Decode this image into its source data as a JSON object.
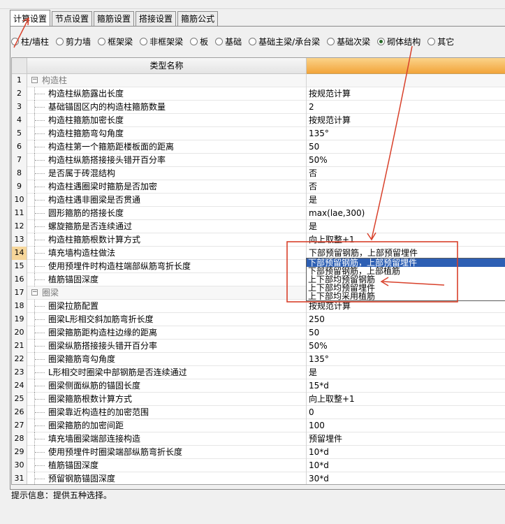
{
  "tabs": [
    {
      "label": "计算设置",
      "active": true
    },
    {
      "label": "节点设置",
      "active": false
    },
    {
      "label": "箍筋设置",
      "active": false
    },
    {
      "label": "搭接设置",
      "active": false
    },
    {
      "label": "箍筋公式",
      "active": false
    }
  ],
  "radios": [
    {
      "label": "柱/墙柱",
      "checked": false
    },
    {
      "label": "剪力墙",
      "checked": false
    },
    {
      "label": "框架梁",
      "checked": false
    },
    {
      "label": "非框架梁",
      "checked": false
    },
    {
      "label": "板",
      "checked": false
    },
    {
      "label": "基础",
      "checked": false
    },
    {
      "label": "基础主梁/承台梁",
      "checked": false
    },
    {
      "label": "基础次梁",
      "checked": false
    },
    {
      "label": "砌体结构",
      "checked": true
    },
    {
      "label": "其它",
      "checked": false
    }
  ],
  "grid": {
    "header_name": "类型名称",
    "rows": [
      {
        "num": "1",
        "name": "构造柱",
        "value": "",
        "group": true
      },
      {
        "num": "2",
        "name": "构造柱纵筋露出长度",
        "value": "按规范计算"
      },
      {
        "num": "3",
        "name": "基础锚固区内的构造柱箍筋数量",
        "value": "2"
      },
      {
        "num": "4",
        "name": "构造柱箍筋加密长度",
        "value": "按规范计算"
      },
      {
        "num": "5",
        "name": "构造柱箍筋弯勾角度",
        "value": "135°"
      },
      {
        "num": "6",
        "name": "构造柱第一个箍筋距楼板面的距离",
        "value": "50"
      },
      {
        "num": "7",
        "name": "构造柱纵筋搭接接头错开百分率",
        "value": "50%"
      },
      {
        "num": "8",
        "name": "是否属于砖混结构",
        "value": "否"
      },
      {
        "num": "9",
        "name": "构造柱遇圈梁时箍筋是否加密",
        "value": "否"
      },
      {
        "num": "10",
        "name": "构造柱遇非圈梁是否贯通",
        "value": "是"
      },
      {
        "num": "11",
        "name": "圆形箍筋的搭接长度",
        "value": "max(lae,300)"
      },
      {
        "num": "12",
        "name": "螺旋箍筋是否连续通过",
        "value": "是"
      },
      {
        "num": "13",
        "name": "构造柱箍筋根数计算方式",
        "value": "向上取整+1"
      },
      {
        "num": "14",
        "name": "填充墙构造柱做法",
        "value": "下部预留钢筋，上部预留埋件",
        "selected": true
      },
      {
        "num": "15",
        "name": "使用预埋件时构造柱端部纵筋弯折长度",
        "value": ""
      },
      {
        "num": "16",
        "name": "植筋锚固深度",
        "value": ""
      },
      {
        "num": "17",
        "name": "圈梁",
        "value": "",
        "group": true
      },
      {
        "num": "18",
        "name": "圈梁拉筋配置",
        "value": "按规范计算"
      },
      {
        "num": "19",
        "name": "圈梁L形相交斜加筋弯折长度",
        "value": "250"
      },
      {
        "num": "20",
        "name": "圈梁箍筋距构造柱边缘的距离",
        "value": "50"
      },
      {
        "num": "21",
        "name": "圈梁纵筋搭接接头错开百分率",
        "value": "50%"
      },
      {
        "num": "22",
        "name": "圈梁箍筋弯勾角度",
        "value": "135°"
      },
      {
        "num": "23",
        "name": "L形相交时圈梁中部钢筋是否连续通过",
        "value": "是"
      },
      {
        "num": "24",
        "name": "圈梁侧面纵筋的锚固长度",
        "value": "15*d"
      },
      {
        "num": "25",
        "name": "圈梁箍筋根数计算方式",
        "value": "向上取整+1"
      },
      {
        "num": "26",
        "name": "圈梁靠近构造柱的加密范围",
        "value": "0"
      },
      {
        "num": "27",
        "name": "圈梁箍筋的加密间距",
        "value": "100"
      },
      {
        "num": "28",
        "name": "填充墙圈梁端部连接构造",
        "value": "预留埋件"
      },
      {
        "num": "29",
        "name": "使用预埋件时圈梁端部纵筋弯折长度",
        "value": "10*d"
      },
      {
        "num": "30",
        "name": "植筋锚固深度",
        "value": "10*d"
      },
      {
        "num": "31",
        "name": "预留钢筋锚固深度",
        "value": "30*d"
      }
    ]
  },
  "dropdown": {
    "options": [
      {
        "label": "下部预留钢筋，上部预留埋件",
        "highlight": true
      },
      {
        "label": "下部预留钢筋，上部植筋"
      },
      {
        "label": "上下部均预留钢筋"
      },
      {
        "label": "上下部均预留埋件"
      },
      {
        "label": "上下部均采用植筋"
      }
    ]
  },
  "status": {
    "text": "提示信息：提供五种选择。"
  },
  "colors": {
    "annotation": "#d8402a",
    "highlight": "#2d5fb4",
    "header_accent": "#f2a43a"
  }
}
